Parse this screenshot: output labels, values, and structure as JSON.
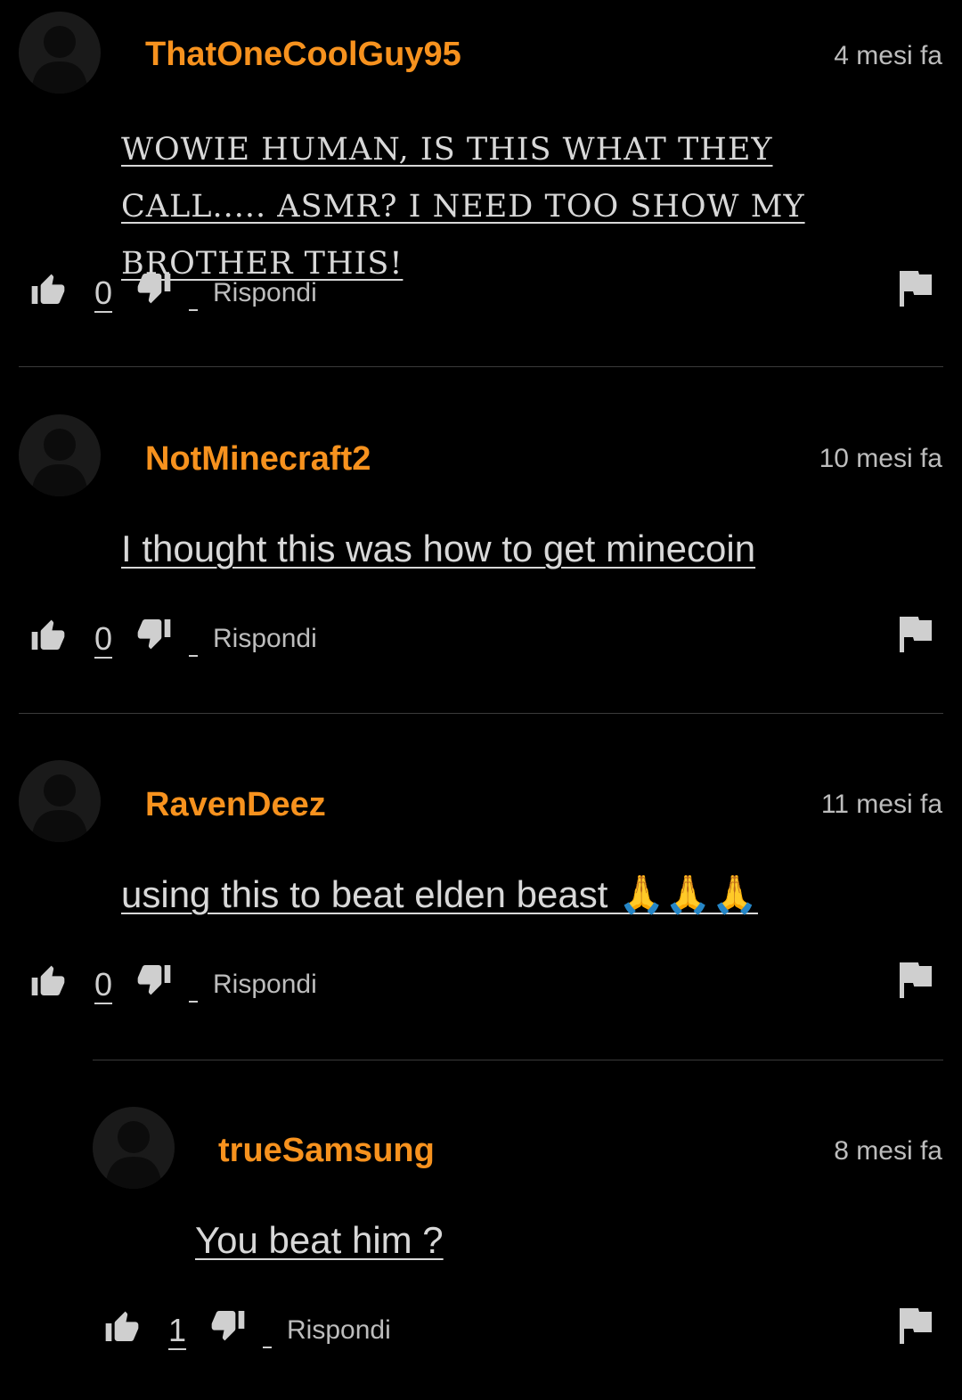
{
  "comments": [
    {
      "username": "ThatOneCoolGuy95",
      "time": "4 mesi fa",
      "text": "WOWIE HUMAN, IS THIS WHAT THEY CALL..... ASMR? I NEED TOO SHOW MY BROTHER THIS!",
      "likes": "0",
      "reply_label": "Rispondi"
    },
    {
      "username": "NotMinecraft2",
      "time": "10 mesi fa",
      "text": "I thought this was how to get minecoin",
      "likes": "0",
      "reply_label": "Rispondi"
    },
    {
      "username": "RavenDeez",
      "time": "11 mesi fa",
      "text": "using this to beat elden beast 🙏🙏🙏",
      "likes": "0",
      "reply_label": "Rispondi"
    },
    {
      "username": "trueSamsung",
      "time": "8 mesi fa",
      "text": "You beat him ?",
      "likes": "1",
      "reply_label": "Rispondi"
    }
  ],
  "colors": {
    "background": "#000000",
    "username": "#f7921e",
    "text": "#d8d8d8",
    "divider": "#3a3a3a"
  },
  "icons": {
    "avatar": "person-silhouette-icon",
    "like": "thumbs-up-icon",
    "dislike": "thumbs-down-icon",
    "report": "flag-icon"
  }
}
